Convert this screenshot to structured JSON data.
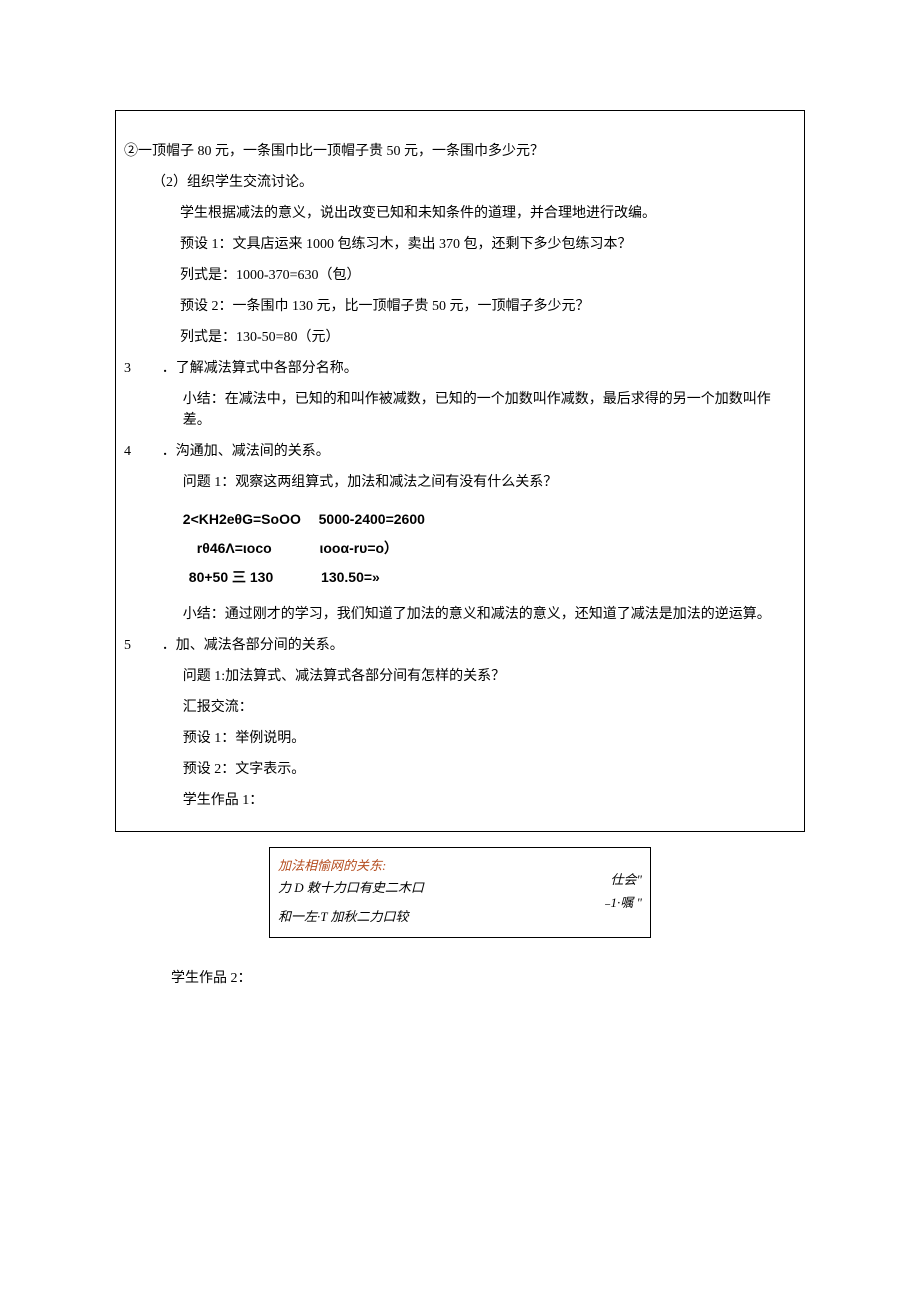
{
  "box": {
    "p1": "②一顶帽子 80 元，一条围巾比一顶帽子贵 50 元，一条围巾多少元？",
    "p2": "（2）组织学生交流讨论。",
    "p3": "学生根据减法的意义，说出改变已知和未知条件的道理，并合理地进行改编。",
    "p4": "预设 1：文具店运来 1000 包练习木，卖出 370 包，还剩下多少包练习本？",
    "p5": "列式是：1000-370=630（包）",
    "p6": "预设 2：一条围巾 130 元，比一顶帽子贵 50 元，一顶帽子多少元？",
    "p7": "列式是：130-50=80（元）",
    "s3_num": "3",
    "s3_title": "．了解减法算式中各部分名称。",
    "s3_p1": "小结：在减法中，已知的和叫作被减数，已知的一个加数叫作减数，最后求得的另一个加数叫作差。",
    "s4_num": "4",
    "s4_title": "．沟通加、减法间的关系。",
    "s4_p1": "问题 1：观察这两组算式，加法和减法之间有没有什么关系？",
    "f1a": "2<KH2eθG=SoOO",
    "f1b": "5000-2400=2600",
    "f2a": "rθ46Λ=ιoco",
    "f2b": "ιooα-rυ=o）",
    "f3a": "80+50 三 130",
    "f3b": "130.50=»",
    "s4_p2": "小结：通过刚才的学习，我们知道了加法的意义和减法的意义，还知道了减法是加法的逆运算。",
    "s5_num": "5",
    "s5_title": "．加、减法各部分间的关系。",
    "s5_p1": "问题 1:加法算式、减法算式各部分间有怎样的关系？",
    "s5_p2": "汇报交流：",
    "s5_p3": "预设 1：举例说明。",
    "s5_p4": "预设 2：文字表示。",
    "s5_p5": "学生作品 1："
  },
  "subbox": {
    "l1": "加法相愉网的关东:",
    "l2": "力 D 敕十力口有史二木口",
    "l3": "和一左·T 加秋二力口较",
    "r1": "仕会\"",
    "r2": "₋1∙嘱 \""
  },
  "after": {
    "work2": "学生作品 2："
  }
}
